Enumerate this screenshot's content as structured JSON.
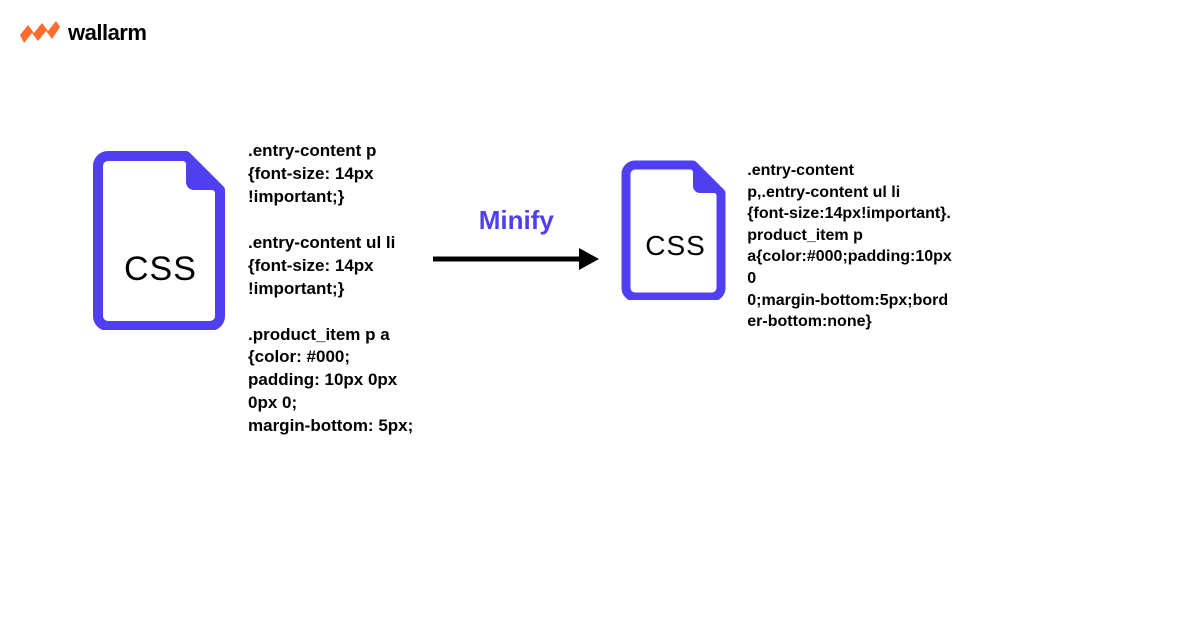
{
  "brand": {
    "name": "wallarm",
    "accent": "#ff6b2c"
  },
  "diagram": {
    "left_file_label": "CSS",
    "right_file_label": "CSS",
    "arrow_label": "Minify",
    "icon_color": "#4f3ff0",
    "source_code": ".entry-content p\n{font-size: 14px\n!important;}\n\n.entry-content ul li\n{font-size: 14px\n!important;}\n\n.product_item p a\n{color: #000;\npadding: 10px 0px\n0px 0;\nmargin-bottom: 5px;",
    "minified_code": ".entry-content\np,.entry-content ul li\n{font-size:14px!important}.\nproduct_item p\na{color:#000;padding:10px\n0\n0;margin-bottom:5px;bord\ner-bottom:none}"
  }
}
